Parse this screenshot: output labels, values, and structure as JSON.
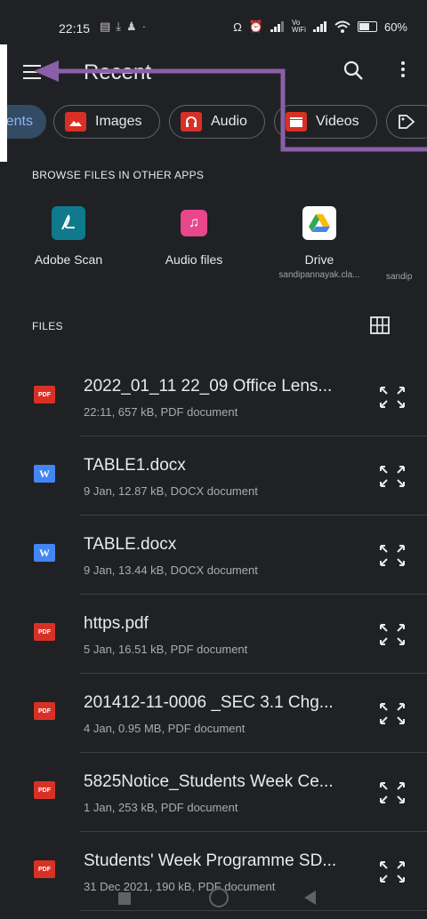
{
  "status_bar": {
    "time": "22:15",
    "battery": "60%",
    "left_icons": [
      "message-icon",
      "download-icon",
      "notification-icon",
      "dot-icon"
    ],
    "right_icons": [
      "headphones-icon",
      "alarm-icon",
      "signal-icon",
      "vowifi-icon",
      "signal-icon-2",
      "wifi-icon",
      "battery-icon"
    ]
  },
  "app_bar": {
    "title": "Recent",
    "menu_icon": "menu-icon",
    "search_icon": "search-icon",
    "more_icon": "more-vert-icon"
  },
  "chips": [
    {
      "label": "ents",
      "icon": null,
      "selected": true
    },
    {
      "label": "Images",
      "icon": "image-icon"
    },
    {
      "label": "Audio",
      "icon": "headphones-icon"
    },
    {
      "label": "Videos",
      "icon": "clapperboard-icon"
    },
    {
      "label": "",
      "icon": "tag-icon"
    }
  ],
  "browse": {
    "header": "BROWSE FILES IN OTHER APPS",
    "apps": [
      {
        "name": "Adobe Scan",
        "sub": "",
        "icon": "adobe-scan-icon",
        "color": "#0e7a8c"
      },
      {
        "name": "Audio files",
        "sub": "",
        "icon": "music-note-icon",
        "color": "#e8478b"
      },
      {
        "name": "Drive",
        "sub": "sandipannayak.cla...",
        "icon": "google-drive-icon",
        "color": "#ffffff"
      },
      {
        "name": "",
        "sub": "sandip",
        "icon": "",
        "color": ""
      }
    ]
  },
  "files": {
    "header": "FILES",
    "grid_icon": "grid-view-icon",
    "items": [
      {
        "name": "2022_01_11 22_09 Office Lens...",
        "meta": "22:11, 657 kB, PDF document",
        "type": "pdf"
      },
      {
        "name": "TABLE1.docx",
        "meta": "9 Jan, 12.87 kB, DOCX document",
        "type": "doc"
      },
      {
        "name": "TABLE.docx",
        "meta": "9 Jan, 13.44 kB, DOCX document",
        "type": "doc"
      },
      {
        "name": "https.pdf",
        "meta": "5 Jan, 16.51 kB, PDF document",
        "type": "pdf"
      },
      {
        "name": "201412-11-0006  _SEC 3.1 Chg...",
        "meta": "4 Jan, 0.95 MB, PDF document",
        "type": "pdf"
      },
      {
        "name": "5825Notice_Students Week Ce...",
        "meta": "1 Jan, 253 kB, PDF document",
        "type": "pdf"
      },
      {
        "name": "Students' Week Programme SD...",
        "meta": "31 Dec 2021, 190 kB, PDF document",
        "type": "pdf"
      }
    ],
    "pdf_badge": "PDF",
    "doc_badge": "W"
  },
  "annotation": {
    "arrow_color": "#8b5fa8"
  },
  "colors": {
    "background": "#202124",
    "accent": "#8ab4f8",
    "pdf": "#d93025",
    "doc": "#4285f4"
  }
}
